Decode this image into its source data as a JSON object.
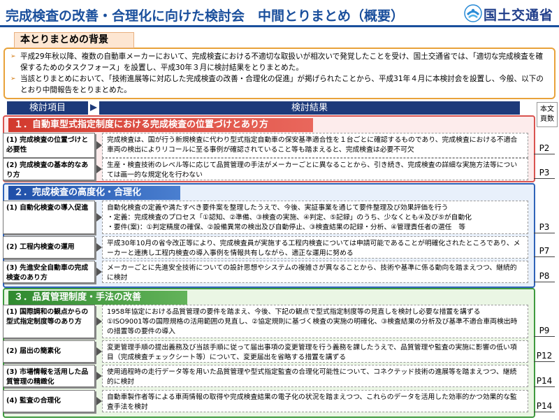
{
  "header": {
    "title": "完成検査の改善・合理化に向けた検討会　中間とりまとめ（概要）",
    "ministry": "国土交通省"
  },
  "background": {
    "heading": "本とりまとめの背景",
    "paragraphs": [
      "平成29年秋以降、複数の自動車メーカーにおいて、完成検査における不適切な取扱いが相次いで発覚したことを受け、国土交通省では、「適切な完成検査を確保するためのタスクフォース」を設置し、平成30年３月に検討結果をとりまとめた。",
      "当該とりまとめにおいて、「技術進展等に対応した完成検査の改善・合理化の促進」が掲げられたことから、平成31年４月に本検討会を設置し、今般、以下のとおり中間報告をとりまとめた。"
    ]
  },
  "columns": {
    "items": "検討項目",
    "results": "検討結果",
    "pages": "本文\n頁数"
  },
  "sections": [
    {
      "title": "１．自動車型式指定制度における完成検査の位置づけとあり方",
      "rows": [
        {
          "item": "(1) 完成検査の位置づけと必要性",
          "result": "完成検査は、国が行う新規検査に代わり型式指定自動車の保安基準適合性を１台ごとに確認するものであり、完成検査における不適合車両の検出によりリコールに至る事例が確認されていること等も踏まえると、完成検査は必要不可欠",
          "page": "P2"
        },
        {
          "item": "(2) 完成検査の基本的なあり方",
          "result": "生産・検査技術のレベル等に応じて品質管理の手法がメーカーごとに異なることから、引き続き、完成検査の詳細な実施方法等については画一的な規定化を行わない",
          "page": "P3"
        }
      ]
    },
    {
      "title": "２．完成検査の高度化・合理化",
      "rows": [
        {
          "item": "(1) 自動化検査の導入促進",
          "result": "自動化検査の定義や満たすべき要件案を整理したうえで、今後、実証事業を通じて要件整理及び効果評価を行う\n・定義：完成検査のプロセス「①認知、②準備、③検査の実施、④判定、⑤記録」のうち、少なくとも④及び⑤が自動化\n・要件(案)：①判定精度の確保、②設備異常の検出及び自動停止、③検査結果の記録・分析、④管理責任者の選任　等",
          "page": "P3"
        },
        {
          "item": "(2) 工程内検査の運用",
          "result": "平成30年10月の省令改正等により、完成検査員が実施する工程内検査については申請可能であることが明確化されたところであり、メーカーと連携し工程内検査の導入事例を情報共有しながら、適正な運用に努める",
          "page": "P7"
        },
        {
          "item": "(3) 先進安全自動車の完成検査のあり方",
          "result": "メーカーごとに先進安全技術についての設計思想やシステムの複雑さが異なることから、技術や基準に係る動向を踏まえつつ、継続的に検討",
          "page": "P8"
        }
      ]
    },
    {
      "title": "３．品質管理制度・手法の改善",
      "rows": [
        {
          "item": "(1) 国際調和の観点からの型式指定制度等のあり方",
          "result": "1958年協定における品質管理の要件を踏まえ、今後、下記の観点で型式指定制度等の見直しを検討し必要な措置を講ずる\n①ISO9001等の国際規格の活用範囲の見直し、②協定規則に基づく検査の実施の明確化、③検査結果の分析及び基準不適合車両検出時の措置等の要件の導入",
          "page": "P9"
        },
        {
          "item": "(2) 届出の簡素化",
          "result": "変更管理手順の提出義務及び当該手順に従って届出事項の変更管理を行う義務を課したうえで、品質管理や監査の実施に影響の低い項目（完成検査チェックシート等）について、変更届出を省略する措置を講ずる",
          "page": "P12"
        },
        {
          "item": "(3) 市場情報を活用した品質管理の精緻化",
          "result": "使用過程時の走行データ等を用いた品質管理や型式指定監査の合理化可能性について、コネクテッド技術の進展等を踏まえつつ、継続的に検討",
          "page": "P14"
        },
        {
          "item": "(4) 監査の合理化",
          "result": "自動車製作者等による車両情報の取得や完成検査結果の電子化の状況を踏まえつつ、これらのデータを活用した効率的かつ効果的な監査手法を検討",
          "page": "P14"
        }
      ]
    }
  ],
  "colors": {
    "header_blue": "#1a4f9c",
    "section1": "#d9534f",
    "section2": "#2f63b8",
    "section3": "#3f9a3f",
    "background_border": "#e8a23a"
  }
}
